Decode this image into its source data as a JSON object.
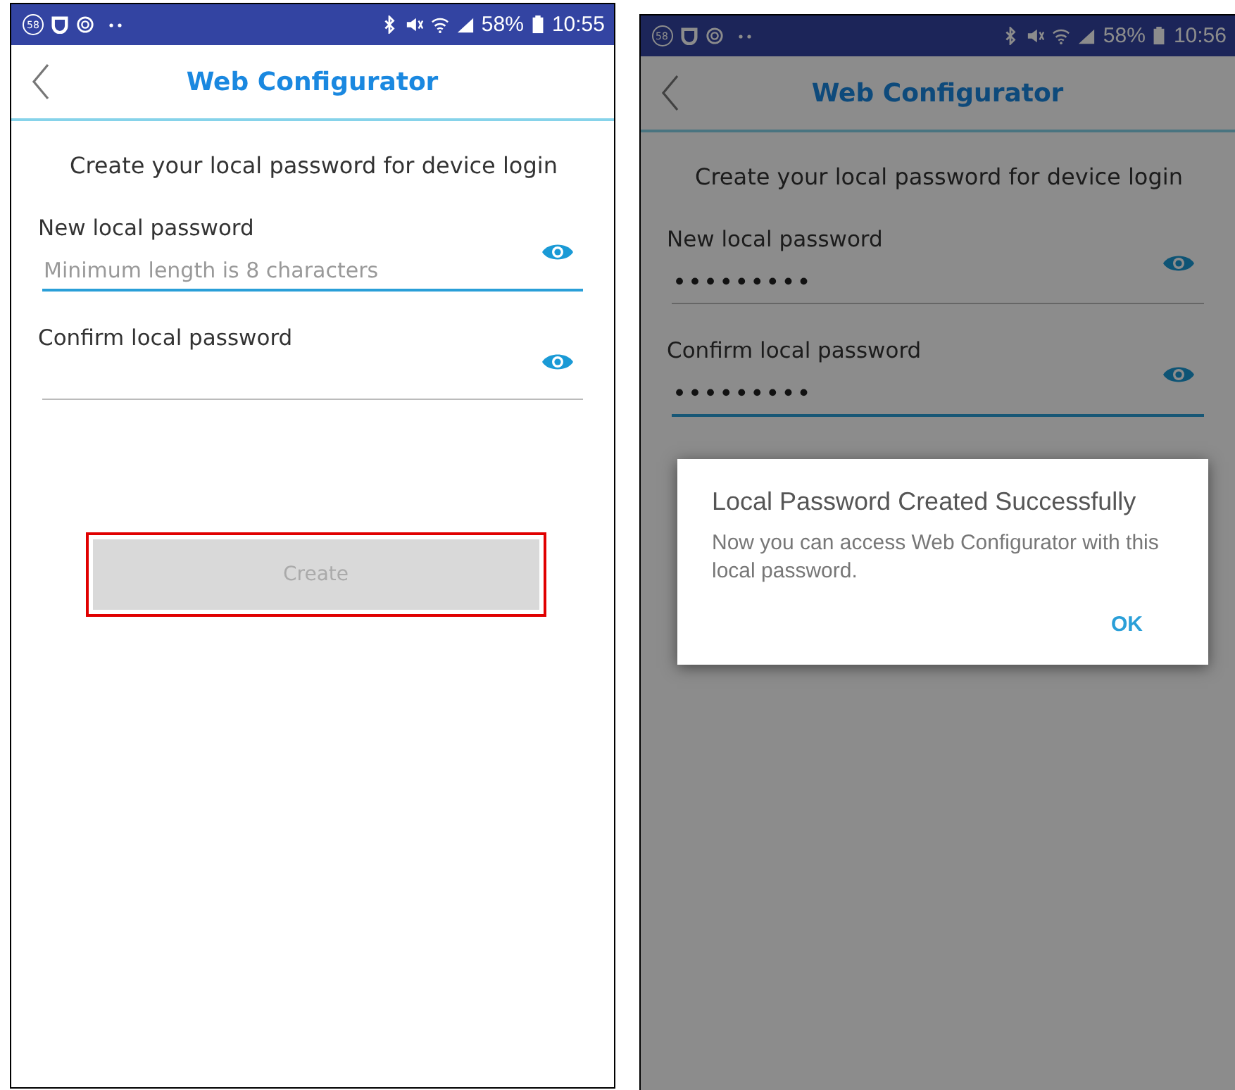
{
  "screens": [
    {
      "status_bar": {
        "badge": "58",
        "battery": "58%",
        "time": "10:55"
      },
      "title": "Web Configurator",
      "intro": "Create your local password for device login",
      "fields": [
        {
          "label": "New local password",
          "placeholder": "Minimum length is 8 characters",
          "focused": true
        },
        {
          "label": "Confirm local password",
          "focused": false
        }
      ],
      "create_button": {
        "label": "Create",
        "disabled": true,
        "highlighted": true
      },
      "dimmed": false
    },
    {
      "status_bar": {
        "badge": "58",
        "battery": "58%",
        "time": "10:56"
      },
      "title": "Web Configurator",
      "intro": "Create your local password for device login",
      "fields": [
        {
          "label": "New local password",
          "value": "•••••••••",
          "focused": false
        },
        {
          "label": "Confirm local password",
          "value": "•••••••••",
          "focused": true
        }
      ],
      "dimmed": true,
      "dialog": {
        "title": "Local Password Created Successfully",
        "message": "Now you can access Web Configurator with this local password.",
        "button": "OK"
      }
    }
  ]
}
